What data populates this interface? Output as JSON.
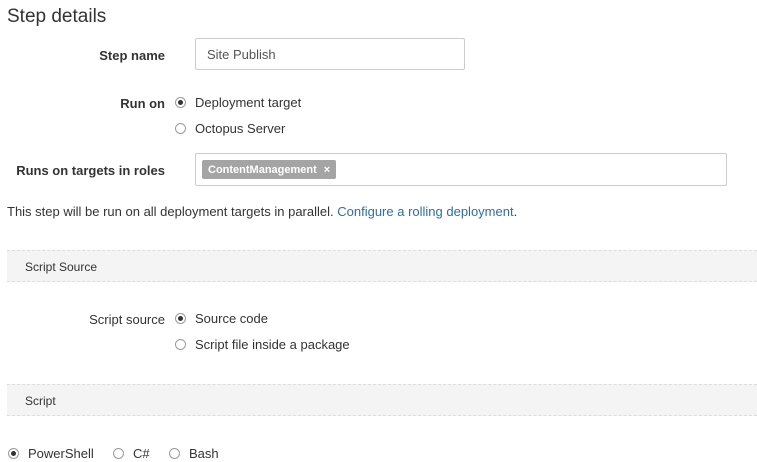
{
  "page": {
    "title": "Step details"
  },
  "step_name": {
    "label": "Step name",
    "value": "Site Publish"
  },
  "run_on": {
    "label": "Run on",
    "options": [
      {
        "label": "Deployment target",
        "selected": true
      },
      {
        "label": "Octopus Server",
        "selected": false
      }
    ]
  },
  "roles": {
    "label": "Runs on targets in roles",
    "chips": [
      "ContentManagement"
    ],
    "remove_glyph": "×"
  },
  "info": {
    "text": "This step will be run on all deployment targets in parallel.",
    "link": "Configure a rolling deployment",
    "suffix": "."
  },
  "script_source_section": {
    "title": "Script Source",
    "label": "Script source",
    "options": [
      {
        "label": "Source code",
        "selected": true
      },
      {
        "label": "Script file inside a package",
        "selected": false
      }
    ]
  },
  "script_section": {
    "title": "Script",
    "languages": [
      {
        "label": "PowerShell",
        "selected": true
      },
      {
        "label": "C#",
        "selected": false
      },
      {
        "label": "Bash",
        "selected": false
      }
    ]
  },
  "colors": {
    "link": "#2e6f9e",
    "chip": "#a4a4a4",
    "section_bg": "#f4f4f4"
  }
}
